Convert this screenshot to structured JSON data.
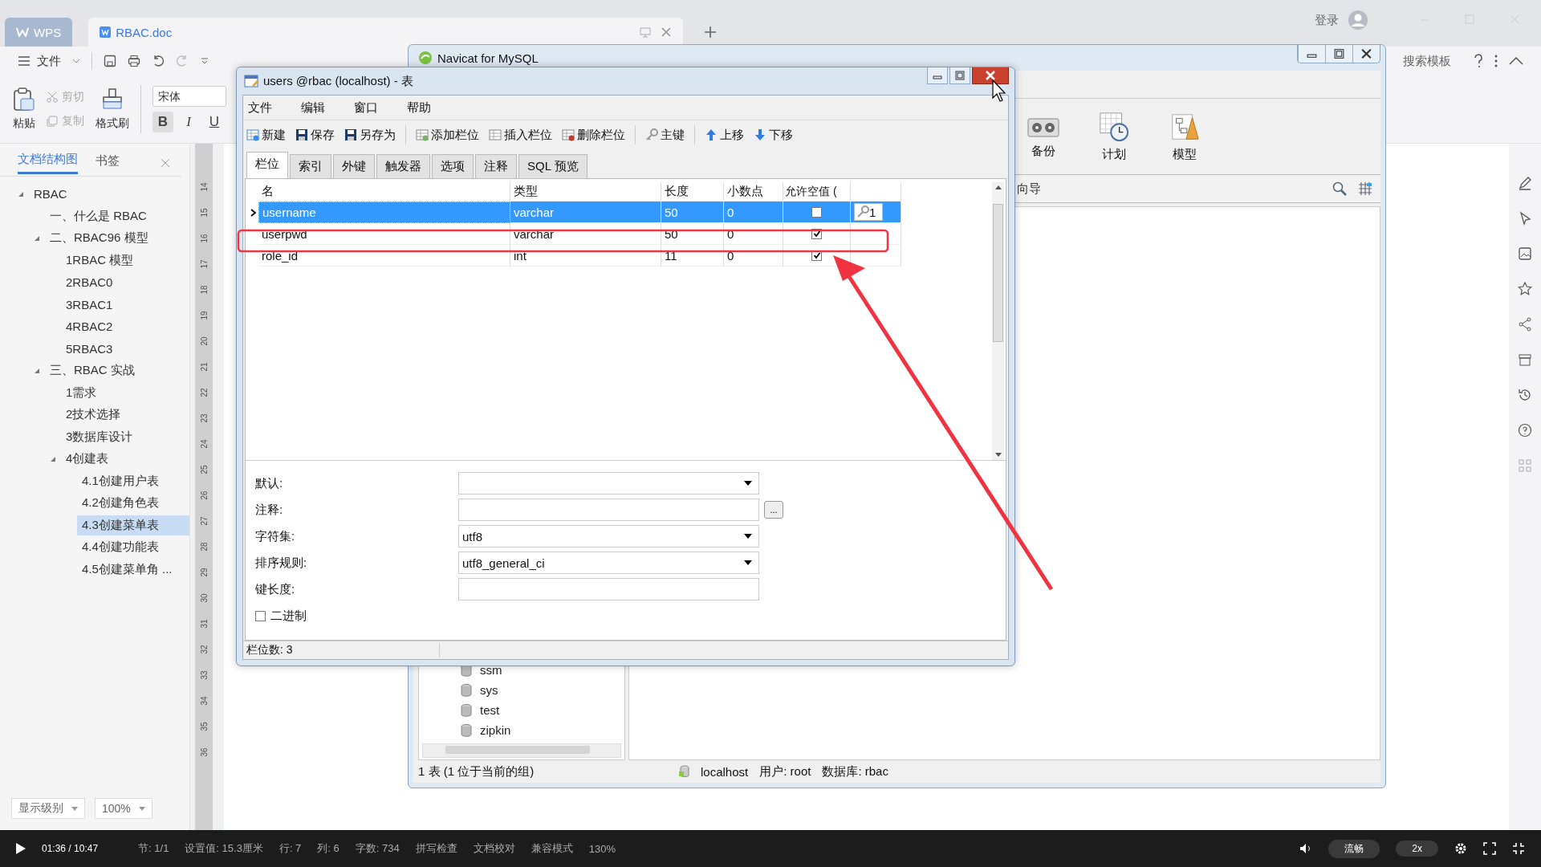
{
  "wps": {
    "tabs": [
      {
        "label": "WPS",
        "kind": "home",
        "selected": false
      },
      {
        "label": "RBAC.doc",
        "kind": "doc",
        "selected": true
      }
    ],
    "login": "登录",
    "file_menu": "文件",
    "clipboard": {
      "paste": "粘贴",
      "cut": "剪切",
      "copy": "复制",
      "format_painter": "格式刷"
    },
    "font": "宋体",
    "format_buttons": [
      {
        "label": "B",
        "kind": "bold",
        "selected": true
      },
      {
        "label": "I",
        "kind": "italic",
        "selected": false
      },
      {
        "label": "U",
        "kind": "underline",
        "selected": false
      }
    ],
    "search_templates": "搜索模板",
    "nav_panel": {
      "tabs": [
        {
          "label": "文档结构图",
          "selected": true
        },
        {
          "label": "书签",
          "selected": false
        }
      ],
      "outline": [
        {
          "label": "RBAC",
          "selected": false,
          "expanded": true,
          "children": [
            {
              "label": "一、什么是 RBAC",
              "selected": false
            },
            {
              "label": "二、RBAC96 模型",
              "selected": false,
              "expanded": true,
              "children": [
                {
                  "label": "1RBAC 模型",
                  "selected": false
                },
                {
                  "label": "2RBAC0",
                  "selected": false
                },
                {
                  "label": "3RBAC1",
                  "selected": false
                },
                {
                  "label": "4RBAC2",
                  "selected": false
                },
                {
                  "label": "5RBAC3",
                  "selected": false
                }
              ]
            },
            {
              "label": "三、RBAC 实战",
              "selected": false,
              "expanded": true,
              "children": [
                {
                  "label": "1需求",
                  "selected": false
                },
                {
                  "label": "2技术选择",
                  "selected": false
                },
                {
                  "label": "3数据库设计",
                  "selected": false
                },
                {
                  "label": "4创建表",
                  "selected": false,
                  "expanded": true,
                  "children": [
                    {
                      "label": "4.1创建用户表",
                      "selected": false
                    },
                    {
                      "label": "4.2创建角色表",
                      "selected": false
                    },
                    {
                      "label": "4.3创建菜单表",
                      "selected": true
                    },
                    {
                      "label": "4.4创建功能表",
                      "selected": false
                    },
                    {
                      "label": "4.5创建菜单角 ...",
                      "selected": false
                    }
                  ]
                }
              ]
            }
          ]
        }
      ],
      "level_button": "显示级别",
      "zoom": "100%"
    },
    "ruler": [
      "14",
      "15",
      "16",
      "17",
      "18",
      "19",
      "20",
      "21",
      "22",
      "23",
      "24",
      "25",
      "26",
      "27",
      "28",
      "29",
      "30",
      "31",
      "32",
      "33",
      "34",
      "35",
      "36"
    ],
    "status_bar": [
      "节: 1/1",
      "设置值: 15.3厘米",
      "行: 7",
      "列: 6",
      "字数: 734",
      "拼写检查",
      "文档校对",
      "兼容模式",
      "130%"
    ]
  },
  "navicat": {
    "title": "Navicat for MySQL",
    "toolbar": [
      {
        "label": "备份",
        "kind": "backup"
      },
      {
        "label": "计划",
        "kind": "schedule"
      },
      {
        "label": "模型",
        "kind": "model"
      }
    ],
    "wizard_label": "向导",
    "databases": [
      "ssm",
      "sys",
      "test",
      "zipkin"
    ],
    "status": {
      "tables": "1 表 (1 位于当前的组)",
      "host": "localhost",
      "user": "用户: root",
      "database": "数据库: rbac"
    }
  },
  "table_designer": {
    "title": "users @rbac (localhost) - 表",
    "menu": [
      "文件",
      "编辑",
      "窗口",
      "帮助"
    ],
    "toolbar": [
      [
        {
          "label": "新建",
          "kind": "new"
        },
        {
          "label": "保存",
          "kind": "save"
        },
        {
          "label": "另存为",
          "kind": "save_as"
        }
      ],
      [
        {
          "label": "添加栏位",
          "kind": "add_field"
        },
        {
          "label": "插入栏位",
          "kind": "insert_field"
        },
        {
          "label": "删除栏位",
          "kind": "delete_field"
        }
      ],
      [
        {
          "label": "主键",
          "kind": "primary_key"
        }
      ],
      [
        {
          "label": "上移",
          "kind": "move_up"
        },
        {
          "label": "下移",
          "kind": "move_down"
        }
      ]
    ],
    "tabs": [
      {
        "label": "栏位",
        "selected": true
      },
      {
        "label": "索引",
        "selected": false
      },
      {
        "label": "外键",
        "selected": false
      },
      {
        "label": "触发器",
        "selected": false
      },
      {
        "label": "选项",
        "selected": false
      },
      {
        "label": "注释",
        "selected": false
      },
      {
        "label": "SQL 预览",
        "selected": false
      }
    ],
    "columns": [
      "名",
      "类型",
      "长度",
      "小数点",
      "允许空值 ("
    ],
    "rows": [
      {
        "name": "username",
        "type": "varchar",
        "length": "50",
        "decimals": "0",
        "nullable": false,
        "key": "1",
        "selected": true
      },
      {
        "name": "userpwd",
        "type": "varchar",
        "length": "50",
        "decimals": "0",
        "nullable": true,
        "selected": false
      },
      {
        "name": "role_id",
        "type": "int",
        "length": "11",
        "decimals": "0",
        "nullable": true,
        "selected": false
      }
    ],
    "properties": [
      {
        "label": "默认:",
        "kind": "dropdown"
      },
      {
        "label": "注释:",
        "kind": "text_with_button",
        "button": "..."
      },
      {
        "label": "字符集:",
        "kind": "dropdown",
        "value": "utf8"
      },
      {
        "label": "排序规则:",
        "kind": "dropdown",
        "value": "utf8_general_ci"
      },
      {
        "label": "键长度:",
        "kind": "text"
      }
    ],
    "binary": {
      "label": "二进制",
      "checked": false
    },
    "status": "栏位数: 3"
  },
  "player": {
    "time": "01:36 / 10:47",
    "quality": "流畅",
    "speed": "2x"
  }
}
